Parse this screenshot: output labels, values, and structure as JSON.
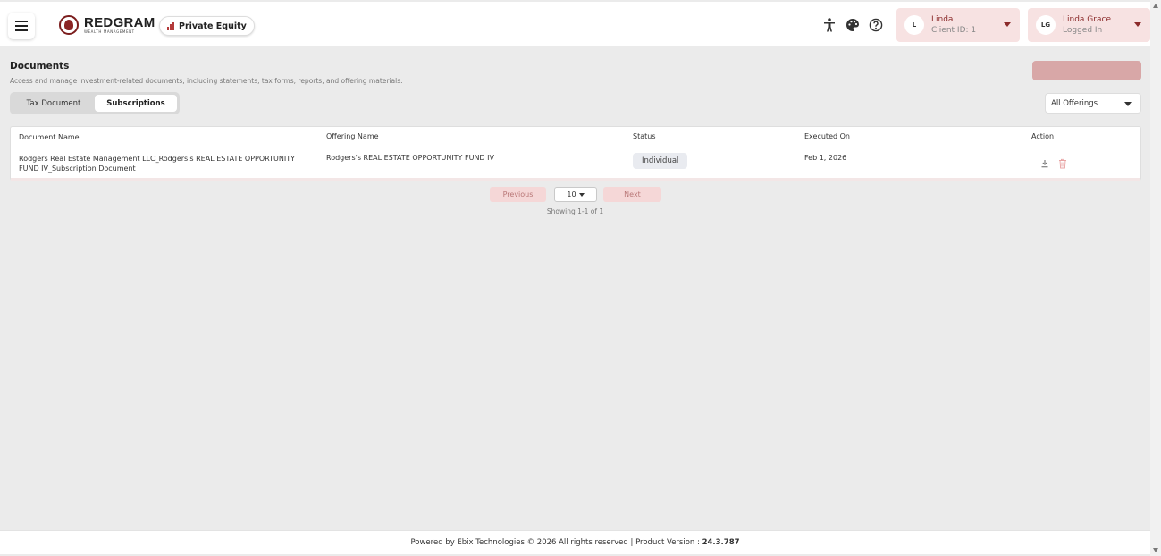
{
  "brand": {
    "name": "REDGRAM",
    "tagline": "WEALTH MANAGEMENT",
    "module_label": "Private Equity",
    "accent_color": "#8b2b2b"
  },
  "header": {
    "icons": [
      "accessibility-icon",
      "palette-icon",
      "help-icon"
    ],
    "client": {
      "initial": "L",
      "name": "Linda",
      "client_id": "Client ID: 1"
    },
    "user": {
      "initials": "LG",
      "name": "Linda Grace",
      "status": "Logged In"
    }
  },
  "page": {
    "title": "Documents",
    "description": "Access and manage investment-related documents, including statements, tax forms, reports, and offering materials."
  },
  "tabs": [
    {
      "label": "Tax Document",
      "active": false
    },
    {
      "label": "Subscriptions",
      "active": true
    }
  ],
  "filter": {
    "selected": "All Offerings"
  },
  "table": {
    "columns": [
      "Document Name",
      "Offering Name",
      "Status",
      "Executed On",
      "Action"
    ],
    "rows": [
      {
        "document_name": "Rodgers Real Estate Management LLC_Rodgers's REAL ESTATE OPPORTUNITY FUND IV_Subscription Document",
        "offering_name": "Rodgers's REAL ESTATE OPPORTUNITY FUND IV",
        "status": "Individual",
        "executed_on": "Feb 1, 2026",
        "actions": [
          "download-icon",
          "delete-icon"
        ]
      }
    ]
  },
  "pagination": {
    "previous_label": "Previous",
    "page_size": "10",
    "next_label": "Next",
    "showing": "Showing 1-1 of 1"
  },
  "footer": {
    "text": "Powered by Ebix Technologies © 2026 All rights reserved | Product Version : ",
    "version": "24.3.787"
  }
}
